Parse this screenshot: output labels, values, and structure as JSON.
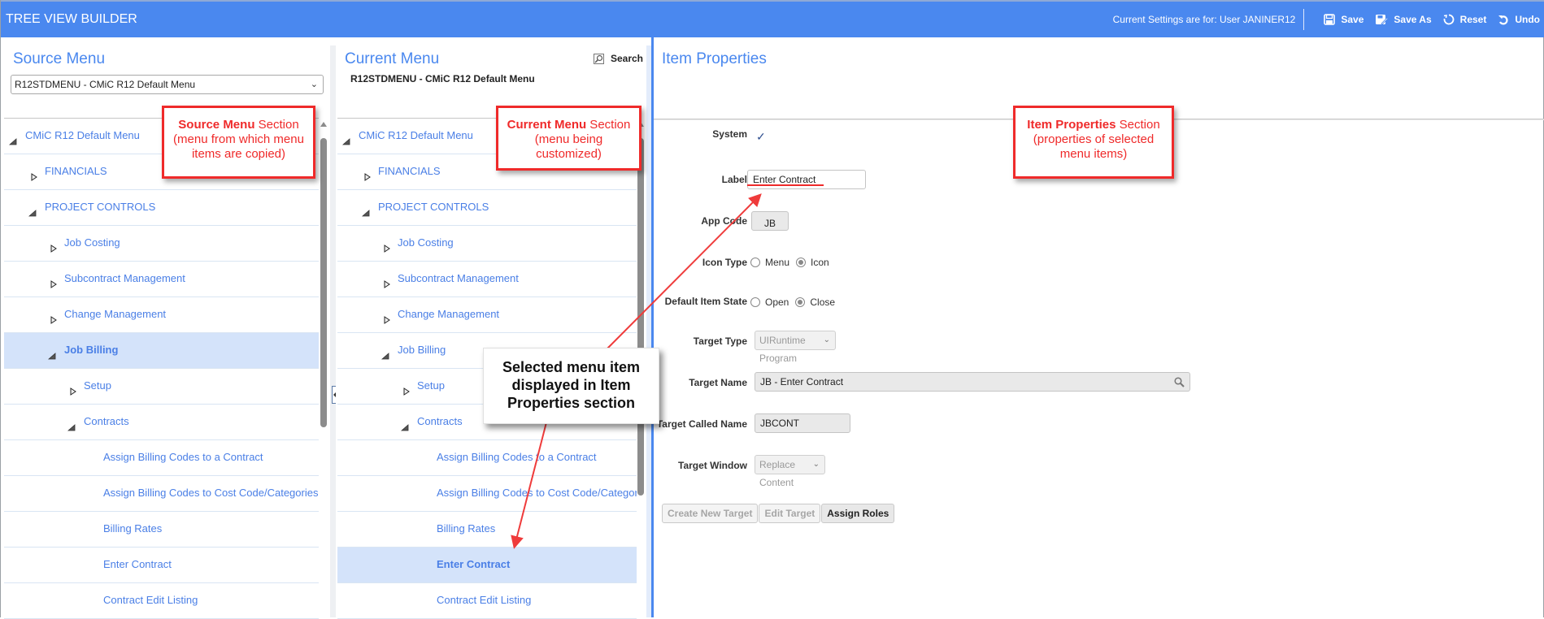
{
  "app": {
    "title": "TREE VIEW BUILDER",
    "settings_text": "Current Settings are for: User JANINER12",
    "toolbar": [
      {
        "id": "save",
        "label": "Save",
        "icon": "save-icon"
      },
      {
        "id": "save-as",
        "label": "Save As",
        "icon": "save-as-icon"
      },
      {
        "id": "reset",
        "label": "Reset",
        "icon": "reset-icon"
      },
      {
        "id": "undo",
        "label": "Undo",
        "icon": "undo-icon"
      }
    ],
    "brand_color": "#4a88ef"
  },
  "source_menu": {
    "title": "Source Menu",
    "selected_menu": "R12STDMENU - CMiC R12 Default Menu",
    "tree": [
      {
        "label": "CMiC R12 Default Menu",
        "level": 0,
        "state": "expanded",
        "selected": false
      },
      {
        "label": "FINANCIALS",
        "level": 1,
        "state": "collapsed",
        "selected": false
      },
      {
        "label": "PROJECT CONTROLS",
        "level": 1,
        "state": "expanded",
        "selected": false
      },
      {
        "label": "Job Costing",
        "level": 2,
        "state": "collapsed",
        "selected": false
      },
      {
        "label": "Subcontract Management",
        "level": 2,
        "state": "collapsed",
        "selected": false
      },
      {
        "label": "Change Management",
        "level": 2,
        "state": "collapsed",
        "selected": false
      },
      {
        "label": "Job Billing",
        "level": 2,
        "state": "expanded",
        "selected": true
      },
      {
        "label": "Setup",
        "level": 3,
        "state": "collapsed",
        "selected": false
      },
      {
        "label": "Contracts",
        "level": 3,
        "state": "expanded",
        "selected": false
      },
      {
        "label": "Assign Billing Codes to a Contract",
        "level": 4,
        "state": "leaf",
        "selected": false
      },
      {
        "label": "Assign Billing Codes to Cost Code/Categories",
        "level": 4,
        "state": "leaf",
        "selected": false
      },
      {
        "label": "Billing Rates",
        "level": 4,
        "state": "leaf",
        "selected": false
      },
      {
        "label": "Enter Contract",
        "level": 4,
        "state": "leaf",
        "selected": false
      },
      {
        "label": "Contract Edit Listing",
        "level": 4,
        "state": "leaf",
        "selected": false
      }
    ]
  },
  "current_menu": {
    "title": "Current Menu",
    "subtitle": "R12STDMENU - CMiC R12 Default Menu",
    "search_label": "Search",
    "tree": [
      {
        "label": "CMiC R12 Default Menu",
        "level": 0,
        "state": "expanded",
        "selected": false
      },
      {
        "label": "FINANCIALS",
        "level": 1,
        "state": "collapsed",
        "selected": false
      },
      {
        "label": "PROJECT CONTROLS",
        "level": 1,
        "state": "expanded",
        "selected": false
      },
      {
        "label": "Job Costing",
        "level": 2,
        "state": "collapsed",
        "selected": false
      },
      {
        "label": "Subcontract Management",
        "level": 2,
        "state": "collapsed",
        "selected": false
      },
      {
        "label": "Change Management",
        "level": 2,
        "state": "collapsed",
        "selected": false
      },
      {
        "label": "Job Billing",
        "level": 2,
        "state": "expanded",
        "selected": false
      },
      {
        "label": "Setup",
        "level": 3,
        "state": "collapsed",
        "selected": false
      },
      {
        "label": "Contracts",
        "level": 3,
        "state": "expanded",
        "selected": false
      },
      {
        "label": "Assign Billing Codes to a Contract",
        "level": 4,
        "state": "leaf",
        "selected": false
      },
      {
        "label": "Assign Billing Codes to Cost Code/Categories",
        "level": 4,
        "state": "leaf",
        "selected": false
      },
      {
        "label": "Billing Rates",
        "level": 4,
        "state": "leaf",
        "selected": false
      },
      {
        "label": "Enter Contract",
        "level": 4,
        "state": "leaf",
        "selected": true
      },
      {
        "label": "Contract Edit Listing",
        "level": 4,
        "state": "leaf",
        "selected": false
      }
    ]
  },
  "item_properties": {
    "title": "Item Properties",
    "fields": {
      "system": {
        "label": "System",
        "checked": true,
        "mark": "✓"
      },
      "label": {
        "label": "Label",
        "value": "Enter Contract"
      },
      "app_code": {
        "label": "App Code",
        "value": "JB"
      },
      "icon_type": {
        "label": "Icon Type",
        "options": [
          "Menu",
          "Icon"
        ],
        "selected": "Icon"
      },
      "default_item_state": {
        "label": "Default Item State",
        "options": [
          "Open",
          "Close"
        ],
        "selected": "Close"
      },
      "target_type": {
        "label": "Target Type",
        "value": "UIRuntime Program"
      },
      "target_name": {
        "label": "Target Name",
        "value": "JB - Enter Contract"
      },
      "target_called_name": {
        "label": "Target Called Name",
        "value": "JBCONT"
      },
      "target_window": {
        "label": "Target Window",
        "value": "Replace Content"
      }
    },
    "buttons": [
      {
        "label": "Create New Target",
        "enabled": false
      },
      {
        "label": "Edit Target",
        "enabled": false
      },
      {
        "label": "Assign Roles",
        "enabled": true
      }
    ]
  },
  "annotations": {
    "source": {
      "bold": "Source Menu",
      "rest": " Section",
      "lines": [
        "(menu from which menu",
        "items are copied)"
      ]
    },
    "current": {
      "bold": "Current Menu",
      "rest": " Section",
      "lines": [
        "(menu being",
        "customized)"
      ]
    },
    "props": {
      "bold": "Item Properties",
      "rest": " Section",
      "lines": [
        "(properties of selected",
        "menu items)"
      ]
    },
    "selected": {
      "lines": [
        "Selected menu item",
        "displayed in Item",
        "Properties section"
      ]
    },
    "annotation_color": "#ef2a2a"
  }
}
